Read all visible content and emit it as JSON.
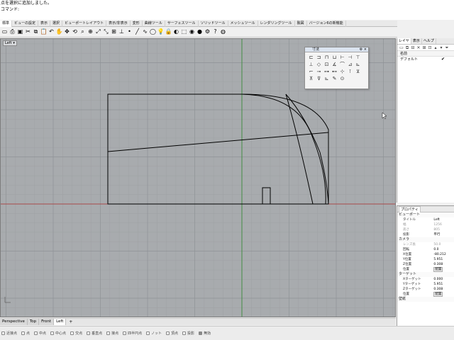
{
  "command": {
    "history": "点を選択に追加しました。",
    "prompt": "コマンド:"
  },
  "tabs": [
    {
      "label": "標準",
      "active": true
    },
    {
      "label": "ビューの設定",
      "active": false
    },
    {
      "label": "表示",
      "active": false
    },
    {
      "label": "選択",
      "active": false
    },
    {
      "label": "ビューポートレイアウト",
      "active": false
    },
    {
      "label": "表示/非表示",
      "active": false
    },
    {
      "label": "変形",
      "active": false
    },
    {
      "label": "曲線ツール",
      "active": false
    },
    {
      "label": "サーフェスツール",
      "active": false
    },
    {
      "label": "ソリッドツール",
      "active": false
    },
    {
      "label": "メッシュツール",
      "active": false
    },
    {
      "label": "レンダリングツール",
      "active": false
    },
    {
      "label": "製図",
      "active": false
    },
    {
      "label": "バージョン6の新機能",
      "active": false
    }
  ],
  "toolbar_icons": [
    {
      "name": "new-file-icon",
      "glyph": "▭"
    },
    {
      "name": "print-icon",
      "glyph": "⎙"
    },
    {
      "name": "save-icon",
      "glyph": "▣"
    },
    {
      "name": "cut-icon",
      "glyph": "✂"
    },
    {
      "name": "copy-icon",
      "glyph": "⧉"
    },
    {
      "name": "paste-icon",
      "glyph": "📋"
    },
    {
      "name": "undo-icon",
      "glyph": "↶"
    },
    {
      "name": "pan-icon",
      "glyph": "✋"
    },
    {
      "name": "move-view-icon",
      "glyph": "✥"
    },
    {
      "name": "rotate-view-icon",
      "glyph": "⟲"
    },
    {
      "name": "zoom-icon",
      "glyph": "⌕"
    },
    {
      "name": "zoom-window-icon",
      "glyph": "⊕"
    },
    {
      "name": "zoom-extents-icon",
      "glyph": "⤢"
    },
    {
      "name": "zoom-selected-icon",
      "glyph": "⤡"
    },
    {
      "name": "four-view-icon",
      "glyph": "⊞"
    },
    {
      "name": "set-cplane-icon",
      "glyph": "⊥"
    },
    {
      "name": "point-icon",
      "glyph": "•"
    },
    {
      "name": "line-icon",
      "glyph": "╱"
    },
    {
      "name": "curve-icon",
      "glyph": "∿"
    },
    {
      "name": "circle-icon",
      "glyph": "◯"
    },
    {
      "name": "lamp-icon",
      "glyph": "💡"
    },
    {
      "name": "lock-icon",
      "glyph": "🔒"
    },
    {
      "name": "show-icon",
      "glyph": "◐"
    },
    {
      "name": "select-icon",
      "glyph": "⬚"
    },
    {
      "name": "render-icon",
      "glyph": "◉"
    },
    {
      "name": "material-icon",
      "glyph": "●"
    },
    {
      "name": "options-icon",
      "glyph": "⚙"
    },
    {
      "name": "help-icon",
      "glyph": "?"
    },
    {
      "name": "globe-icon",
      "glyph": "◍"
    }
  ],
  "viewport": {
    "label": "Left",
    "arrow": "▾"
  },
  "dim_panel": {
    "title": "寸法",
    "controls": "⚙ ×",
    "icons": [
      "⊏",
      "⊐",
      "⊓",
      "⊔",
      "⊢",
      "⊣",
      "⊤",
      "⊥",
      "◇",
      "⊡",
      "∡",
      "⌒",
      "⊿",
      "⊾",
      "⌐",
      "⊸",
      "⊶",
      "⊷",
      "⊹",
      "⊺",
      "⊻",
      "⊼",
      "⊽",
      "⊾",
      "✎",
      "⊙"
    ]
  },
  "view_tabs": [
    {
      "label": "Perspective",
      "active": false
    },
    {
      "label": "Top",
      "active": false
    },
    {
      "label": "Front",
      "active": false
    },
    {
      "label": "Left",
      "active": true
    }
  ],
  "add_tab": "+",
  "osnaps": [
    {
      "label": "近接点",
      "checked": false
    },
    {
      "label": "点",
      "checked": false
    },
    {
      "label": "中点",
      "checked": false
    },
    {
      "label": "中心点",
      "checked": false
    },
    {
      "label": "交点",
      "checked": false
    },
    {
      "label": "垂直点",
      "checked": false
    },
    {
      "label": "接点",
      "checked": false
    },
    {
      "label": "四半円点",
      "checked": false
    },
    {
      "label": "ノット",
      "checked": false
    },
    {
      "label": "頂点",
      "checked": false
    },
    {
      "label": "投影",
      "checked": false
    },
    {
      "label": "無効",
      "checked": true
    }
  ],
  "layers": {
    "tabs": [
      {
        "label": "レイヤ",
        "active": true
      },
      {
        "label": "表示",
        "active": false
      },
      {
        "label": "ヘルプ",
        "active": false
      }
    ],
    "tools": [
      "▭",
      "⧉",
      "⊟",
      "✕",
      "⊞",
      "⊡",
      "▴",
      "▾",
      "⏷"
    ],
    "header": "名前",
    "rows": [
      {
        "name": "デフォルト",
        "check": "✔"
      }
    ]
  },
  "props": {
    "tab": "プロパティ",
    "sections": [
      {
        "title": "ビューポート",
        "rows": [
          {
            "key": "タイトル",
            "value": "Left",
            "dim": false
          },
          {
            "key": "幅",
            "value": "1256",
            "dim": true
          },
          {
            "key": "高さ",
            "value": "805",
            "dim": true
          },
          {
            "key": "投影",
            "value": "平行",
            "dim": false
          }
        ]
      },
      {
        "title": "カメラ",
        "rows": [
          {
            "key": "レンズ長",
            "value": "50.0",
            "dim": true
          },
          {
            "key": "回転",
            "value": "0.0",
            "dim": false
          },
          {
            "key": "X位置",
            "value": "-80.212",
            "dim": false
          },
          {
            "key": "Y位置",
            "value": "5.951",
            "dim": false
          },
          {
            "key": "Z位置",
            "value": "0.308",
            "dim": false
          },
          {
            "key": "位置",
            "value": "配置",
            "dim": false,
            "button": true
          }
        ]
      },
      {
        "title": "ターゲット",
        "rows": [
          {
            "key": "Xターゲット",
            "value": "0.000",
            "dim": false
          },
          {
            "key": "Yターゲット",
            "value": "5.951",
            "dim": false
          },
          {
            "key": "Zターゲット",
            "value": "0.308",
            "dim": false
          },
          {
            "key": "位置",
            "value": "配置",
            "dim": false,
            "button": true
          }
        ]
      },
      {
        "title": "壁紙",
        "rows": []
      }
    ]
  },
  "colors": {
    "viewport_bg": "#a8abae",
    "grid_minor": "#9ea1a4",
    "grid_major": "#8f9296",
    "axis_x": "#b03030",
    "axis_y": "#2e8b2e",
    "curve": "#000000"
  }
}
